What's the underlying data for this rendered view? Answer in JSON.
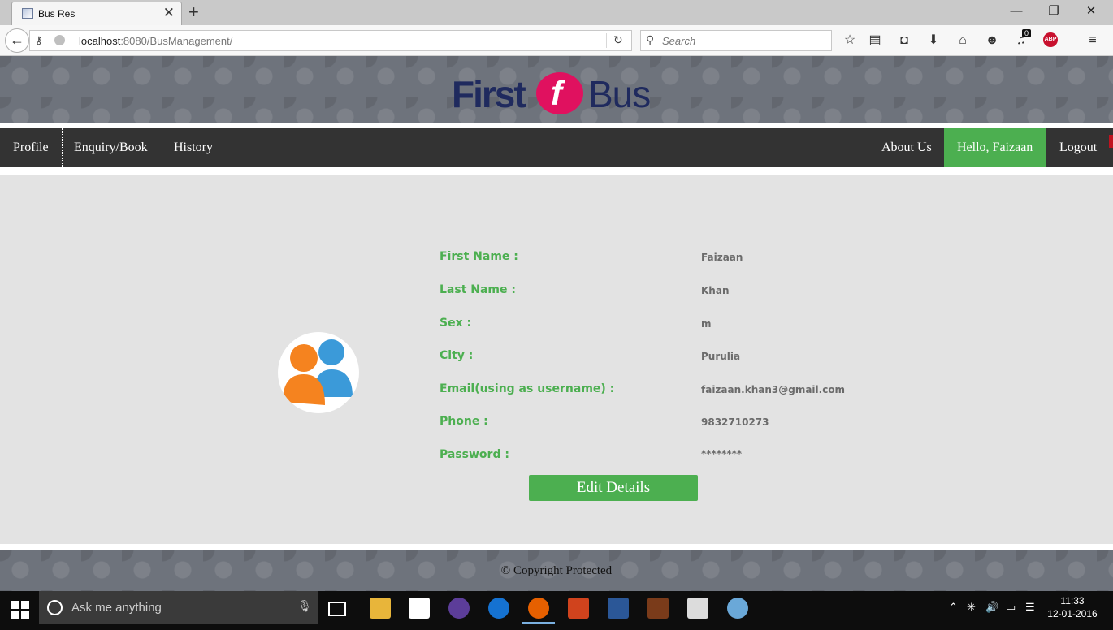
{
  "browser": {
    "tab_title": "Bus Res",
    "tab_close": "✕",
    "new_tab": "+",
    "url_host": "localhost",
    "url_rest": ":8080/BusManagement/",
    "search_placeholder": "Search",
    "notification_count": "0",
    "adblock_label": "ABP"
  },
  "site": {
    "logo_first": "First",
    "logo_f": "f",
    "logo_bus": "Bus",
    "nav_left": [
      "Profile",
      "Enquiry/Book",
      "History"
    ],
    "nav_right": {
      "about": "About Us",
      "hello": "Hello, Faizaan",
      "logout": "Logout"
    },
    "accent_color": "#4caf50"
  },
  "profile": {
    "fields": [
      {
        "label": "First Name  :",
        "value": "Faizaan"
      },
      {
        "label": "Last Name  :",
        "value": "Khan"
      },
      {
        "label": "Sex  :",
        "value": "m"
      },
      {
        "label": "City  :",
        "value": "Purulia"
      },
      {
        "label": "Email(using as username)  :",
        "value": "faizaan.khan3@gmail.com"
      },
      {
        "label": "Phone  :",
        "value": "9832710273"
      },
      {
        "label": "Password  :",
        "value": "********"
      }
    ],
    "edit_button": "Edit Details"
  },
  "footer": {
    "text": "© Copyright Protected"
  },
  "taskbar": {
    "search_placeholder": "Ask me anything",
    "time": "11:33",
    "date": "12-01-2016"
  }
}
